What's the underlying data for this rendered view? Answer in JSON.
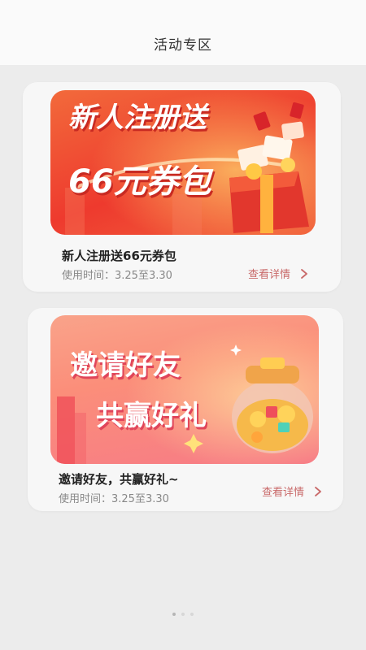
{
  "header": {
    "title": "活动专区"
  },
  "cards": [
    {
      "banner_line1": "新人注册送",
      "banner_line2": "66元券包",
      "title": "新人注册送66元券包",
      "time": "使用时间：3.25至3.30",
      "link": "查看详情"
    },
    {
      "banner_line1": "邀请好友",
      "banner_line2": "共赢好礼",
      "title": "邀请好友，共赢好礼~",
      "time": "使用时间：3.25至3.30",
      "link": "查看详情"
    }
  ],
  "pager": {
    "count": 3,
    "active": 0
  },
  "colors": {
    "accent_link": "#c96a6a",
    "banner1": "#ee3a2e",
    "banner2": "#fb8e7a"
  }
}
